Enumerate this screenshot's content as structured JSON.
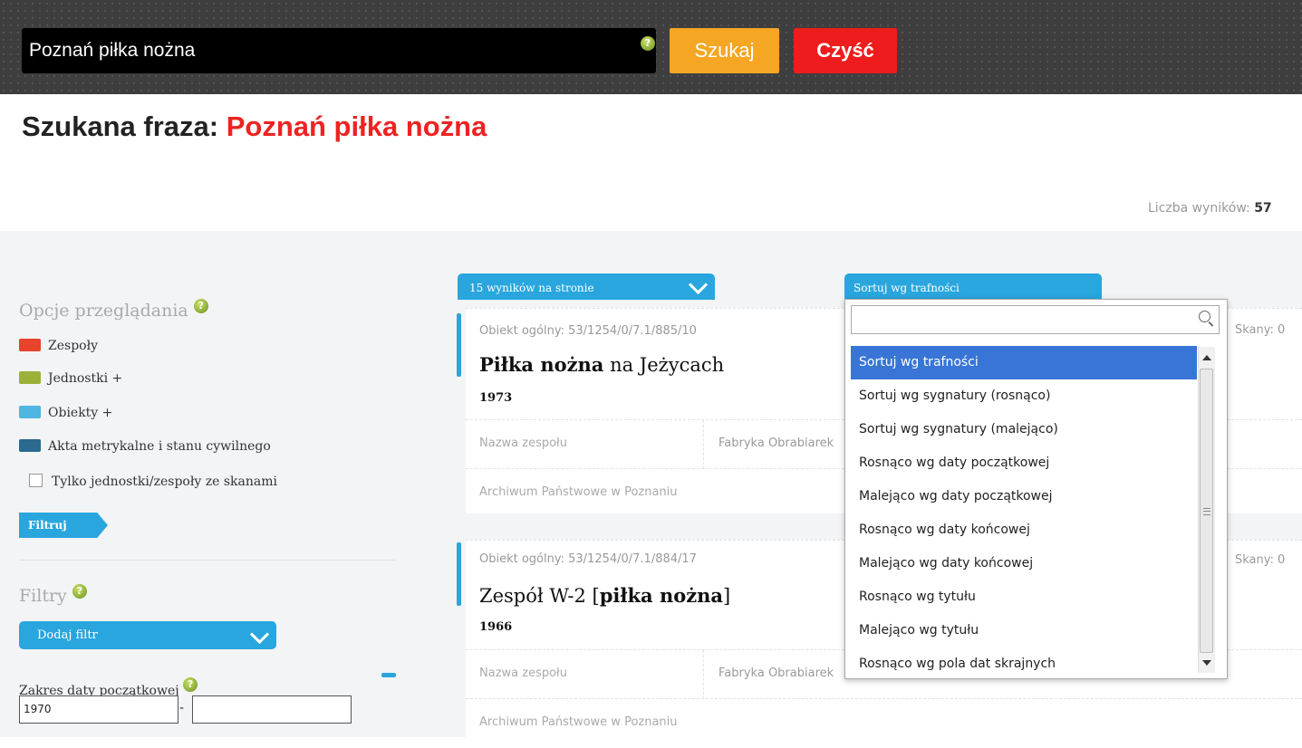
{
  "search": {
    "query": "Poznań piłka nożna",
    "search_label": "Szukaj",
    "clear_label": "Czyść",
    "help": "?"
  },
  "heading": {
    "prefix": "Szukana fraza:",
    "phrase": "Poznań piłka nożna"
  },
  "results_count": {
    "label": "Liczba wyników:",
    "value": "57"
  },
  "sidebar": {
    "browse_title": "Opcje przeglądania",
    "legend": [
      {
        "label": "Zespoły",
        "color": "#e8432b"
      },
      {
        "label": "Jednostki +",
        "color": "#9ab13a"
      },
      {
        "label": "Obiekty +",
        "color": "#4fb6e3"
      },
      {
        "label": "Akta metrykalne i stanu cywilnego",
        "color": "#2b6a8e"
      }
    ],
    "checkbox_label": "Tylko jednostki/zespoły ze skanami",
    "filter_button": "Filtruj",
    "filters_title": "Filtry",
    "add_filter": "Dodaj filtr",
    "date_range_label": "Zakres daty początkowej",
    "date_from": "1970",
    "date_to": "",
    "date_separator": "-"
  },
  "controls": {
    "per_page": "15 wyników na stronie",
    "sort": "Sortuj wg trafności"
  },
  "results": [
    {
      "meta": "Obiekt ogólny: 53/1254/0/7.1/885/10",
      "title_bold": "Piłka nożna",
      "title_rest": " na Jeżycach",
      "year": "1973",
      "fond_label": "Nazwa zespołu",
      "fond_value": "Fabryka Obrabiarek",
      "archive": "Archiwum Państwowe w Poznaniu",
      "scans": "Skany: 0"
    },
    {
      "meta": "Obiekt ogólny: 53/1254/0/7.1/884/17",
      "title_prefix": "Zespół W-2 [",
      "title_bold": "piłka nożna",
      "title_suffix": "]",
      "year": "1966",
      "fond_label": "Nazwa zespołu",
      "fond_value": "Fabryka Obrabiarek",
      "archive": "Archiwum Państwowe w Poznaniu",
      "scans": "Skany: 0"
    }
  ],
  "sort_dropdown": {
    "search_value": "",
    "options": [
      "Sortuj wg trafności",
      "Sortuj wg sygnatury (rosnąco)",
      "Sortuj wg sygnatury (malejąco)",
      "Rosnąco wg daty początkowej",
      "Malejąco wg daty początkowej",
      "Rosnąco wg daty końcowej",
      "Malejąco wg daty końcowej",
      "Rosnąco wg tytułu",
      "Malejąco wg tytułu",
      "Rosnąco wg pola dat skrajnych"
    ],
    "selected": "Sortuj wg trafności"
  },
  "colors": {
    "accent": "#29a6de",
    "search_button": "#f5a623",
    "clear_button": "#ee1c1c",
    "phrase": "#ee2222",
    "dropdown_highlight": "#3875d7"
  }
}
